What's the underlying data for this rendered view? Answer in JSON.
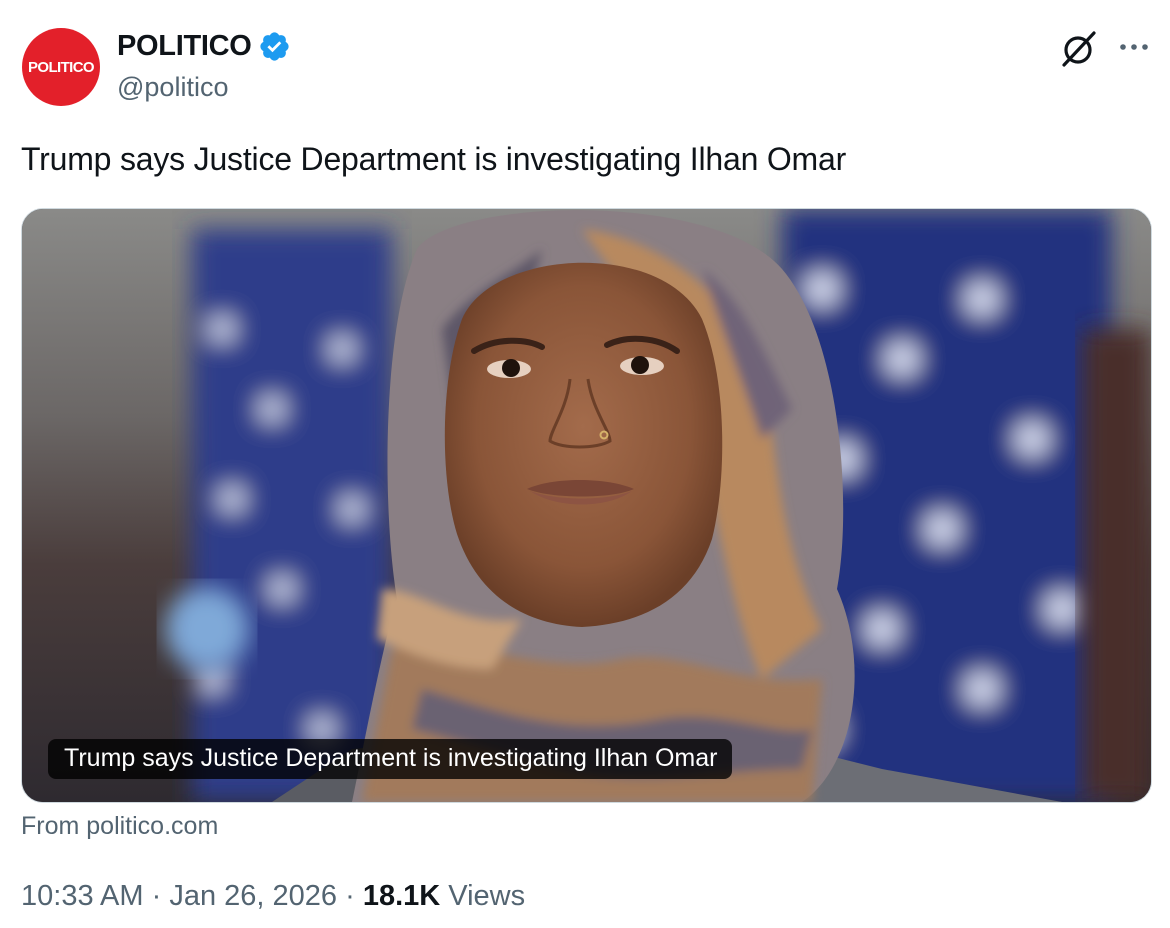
{
  "author": {
    "avatar_text": "POLITICO",
    "display_name": "POLITICO",
    "handle": "@politico",
    "verified": true,
    "verified_color": "#1d9bf0",
    "brand_color": "#e3202a"
  },
  "header_actions": {
    "grok_icon": "grok-icon",
    "more_icon": "more-dots-icon"
  },
  "tweet": {
    "text": "Trump says Justice Department is investigating Ilhan Omar"
  },
  "link_card": {
    "caption": "Trump says Justice Department is investigating Ilhan Omar",
    "source": "From politico.com"
  },
  "meta": {
    "time": "10:33 AM",
    "separator": "·",
    "date": "Jan 26, 2026",
    "views_count": "18.1K",
    "views_label": "Views"
  }
}
